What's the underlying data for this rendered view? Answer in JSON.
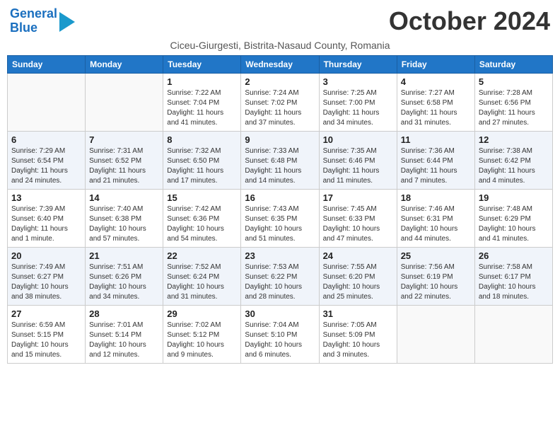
{
  "logo": {
    "line1": "General",
    "line2": "Blue"
  },
  "title": "October 2024",
  "subtitle": "Ciceu-Giurgesti, Bistrita-Nasaud County, Romania",
  "days_of_week": [
    "Sunday",
    "Monday",
    "Tuesday",
    "Wednesday",
    "Thursday",
    "Friday",
    "Saturday"
  ],
  "weeks": [
    [
      {
        "day": "",
        "info": ""
      },
      {
        "day": "",
        "info": ""
      },
      {
        "day": "1",
        "info": "Sunrise: 7:22 AM\nSunset: 7:04 PM\nDaylight: 11 hours and 41 minutes."
      },
      {
        "day": "2",
        "info": "Sunrise: 7:24 AM\nSunset: 7:02 PM\nDaylight: 11 hours and 37 minutes."
      },
      {
        "day": "3",
        "info": "Sunrise: 7:25 AM\nSunset: 7:00 PM\nDaylight: 11 hours and 34 minutes."
      },
      {
        "day": "4",
        "info": "Sunrise: 7:27 AM\nSunset: 6:58 PM\nDaylight: 11 hours and 31 minutes."
      },
      {
        "day": "5",
        "info": "Sunrise: 7:28 AM\nSunset: 6:56 PM\nDaylight: 11 hours and 27 minutes."
      }
    ],
    [
      {
        "day": "6",
        "info": "Sunrise: 7:29 AM\nSunset: 6:54 PM\nDaylight: 11 hours and 24 minutes."
      },
      {
        "day": "7",
        "info": "Sunrise: 7:31 AM\nSunset: 6:52 PM\nDaylight: 11 hours and 21 minutes."
      },
      {
        "day": "8",
        "info": "Sunrise: 7:32 AM\nSunset: 6:50 PM\nDaylight: 11 hours and 17 minutes."
      },
      {
        "day": "9",
        "info": "Sunrise: 7:33 AM\nSunset: 6:48 PM\nDaylight: 11 hours and 14 minutes."
      },
      {
        "day": "10",
        "info": "Sunrise: 7:35 AM\nSunset: 6:46 PM\nDaylight: 11 hours and 11 minutes."
      },
      {
        "day": "11",
        "info": "Sunrise: 7:36 AM\nSunset: 6:44 PM\nDaylight: 11 hours and 7 minutes."
      },
      {
        "day": "12",
        "info": "Sunrise: 7:38 AM\nSunset: 6:42 PM\nDaylight: 11 hours and 4 minutes."
      }
    ],
    [
      {
        "day": "13",
        "info": "Sunrise: 7:39 AM\nSunset: 6:40 PM\nDaylight: 11 hours and 1 minute."
      },
      {
        "day": "14",
        "info": "Sunrise: 7:40 AM\nSunset: 6:38 PM\nDaylight: 10 hours and 57 minutes."
      },
      {
        "day": "15",
        "info": "Sunrise: 7:42 AM\nSunset: 6:36 PM\nDaylight: 10 hours and 54 minutes."
      },
      {
        "day": "16",
        "info": "Sunrise: 7:43 AM\nSunset: 6:35 PM\nDaylight: 10 hours and 51 minutes."
      },
      {
        "day": "17",
        "info": "Sunrise: 7:45 AM\nSunset: 6:33 PM\nDaylight: 10 hours and 47 minutes."
      },
      {
        "day": "18",
        "info": "Sunrise: 7:46 AM\nSunset: 6:31 PM\nDaylight: 10 hours and 44 minutes."
      },
      {
        "day": "19",
        "info": "Sunrise: 7:48 AM\nSunset: 6:29 PM\nDaylight: 10 hours and 41 minutes."
      }
    ],
    [
      {
        "day": "20",
        "info": "Sunrise: 7:49 AM\nSunset: 6:27 PM\nDaylight: 10 hours and 38 minutes."
      },
      {
        "day": "21",
        "info": "Sunrise: 7:51 AM\nSunset: 6:26 PM\nDaylight: 10 hours and 34 minutes."
      },
      {
        "day": "22",
        "info": "Sunrise: 7:52 AM\nSunset: 6:24 PM\nDaylight: 10 hours and 31 minutes."
      },
      {
        "day": "23",
        "info": "Sunrise: 7:53 AM\nSunset: 6:22 PM\nDaylight: 10 hours and 28 minutes."
      },
      {
        "day": "24",
        "info": "Sunrise: 7:55 AM\nSunset: 6:20 PM\nDaylight: 10 hours and 25 minutes."
      },
      {
        "day": "25",
        "info": "Sunrise: 7:56 AM\nSunset: 6:19 PM\nDaylight: 10 hours and 22 minutes."
      },
      {
        "day": "26",
        "info": "Sunrise: 7:58 AM\nSunset: 6:17 PM\nDaylight: 10 hours and 18 minutes."
      }
    ],
    [
      {
        "day": "27",
        "info": "Sunrise: 6:59 AM\nSunset: 5:15 PM\nDaylight: 10 hours and 15 minutes."
      },
      {
        "day": "28",
        "info": "Sunrise: 7:01 AM\nSunset: 5:14 PM\nDaylight: 10 hours and 12 minutes."
      },
      {
        "day": "29",
        "info": "Sunrise: 7:02 AM\nSunset: 5:12 PM\nDaylight: 10 hours and 9 minutes."
      },
      {
        "day": "30",
        "info": "Sunrise: 7:04 AM\nSunset: 5:10 PM\nDaylight: 10 hours and 6 minutes."
      },
      {
        "day": "31",
        "info": "Sunrise: 7:05 AM\nSunset: 5:09 PM\nDaylight: 10 hours and 3 minutes."
      },
      {
        "day": "",
        "info": ""
      },
      {
        "day": "",
        "info": ""
      }
    ]
  ]
}
